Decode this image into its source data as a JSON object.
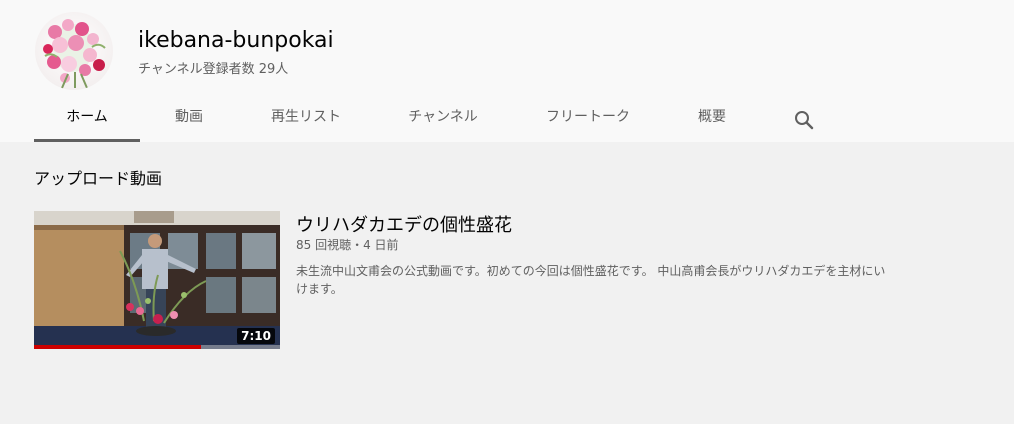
{
  "channel": {
    "name": "ikebana-bunpokai",
    "subscribers": "チャンネル登録者数 29人"
  },
  "tabs": [
    {
      "label": "ホーム",
      "active": true
    },
    {
      "label": "動画"
    },
    {
      "label": "再生リスト"
    },
    {
      "label": "チャンネル"
    },
    {
      "label": "フリートーク"
    },
    {
      "label": "概要"
    }
  ],
  "search_icon": "search-icon",
  "uploads": {
    "section_title": "アップロード動画",
    "video": {
      "title": "ウリハダカエデの個性盛花",
      "meta": "85 回視聴・4 日前",
      "description": "未生流中山文甫会の公式動画です。初めての今回は個性盛花です。 中山高甫会長がウリハダカエデを主材にいけます。",
      "duration": "7:10",
      "watched_fraction": 0.68
    }
  },
  "colors": {
    "accent": "#cc0000",
    "header_bg": "#f9f9f9",
    "page_bg": "#f1f1f1"
  }
}
